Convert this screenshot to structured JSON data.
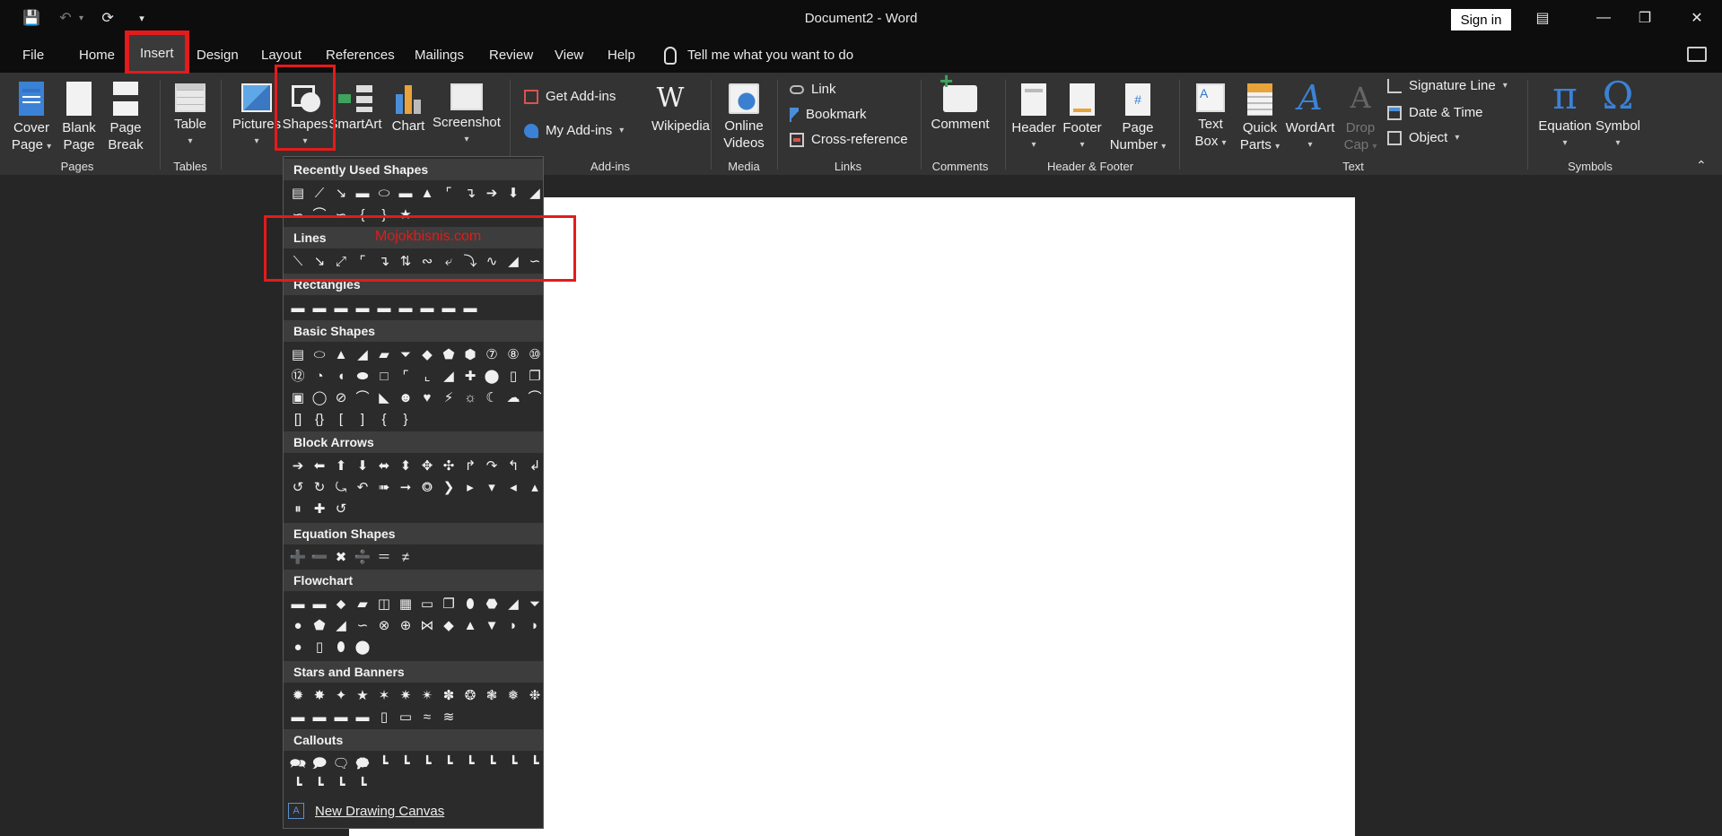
{
  "window": {
    "title": "Document2 - Word",
    "sign_in": "Sign in"
  },
  "tabs": [
    {
      "label": "File"
    },
    {
      "label": "Home"
    },
    {
      "label": "Insert"
    },
    {
      "label": "Design"
    },
    {
      "label": "Layout"
    },
    {
      "label": "References"
    },
    {
      "label": "Mailings"
    },
    {
      "label": "Review"
    },
    {
      "label": "View"
    },
    {
      "label": "Help"
    }
  ],
  "tell_me": "Tell me what you want to do",
  "ribbon": {
    "pages": {
      "label": "Pages",
      "cover": [
        "Cover",
        "Page"
      ],
      "blank": [
        "Blank",
        "Page"
      ],
      "break": [
        "Page",
        "Break"
      ]
    },
    "tables": {
      "label": "Tables",
      "table": "Table"
    },
    "illustrations": {
      "pictures": "Pictures",
      "shapes": "Shapes",
      "smartart": "SmartArt",
      "chart": "Chart",
      "screenshot": "Screenshot"
    },
    "addins": {
      "label": "Add-ins",
      "get": "Get Add-ins",
      "my": "My Add-ins",
      "wikipedia": "Wikipedia"
    },
    "media": {
      "label": "Media",
      "online": [
        "Online",
        "Videos"
      ]
    },
    "links": {
      "label": "Links",
      "link": "Link",
      "bookmark": "Bookmark",
      "cross": "Cross-reference"
    },
    "comments": {
      "label": "Comments",
      "comment": "Comment"
    },
    "headerfooter": {
      "label": "Header & Footer",
      "header": "Header",
      "footer": "Footer",
      "page_number": [
        "Page",
        "Number"
      ]
    },
    "text": {
      "label": "Text",
      "textbox": [
        "Text",
        "Box"
      ],
      "quick": [
        "Quick",
        "Parts"
      ],
      "wordart": "WordArt",
      "dropcap": [
        "Drop",
        "Cap"
      ],
      "signature": "Signature Line",
      "datetime": "Date & Time",
      "object": "Object"
    },
    "symbols": {
      "label": "Symbols",
      "equation": "Equation",
      "symbol": "Symbol"
    }
  },
  "shapes_menu": {
    "sections": [
      {
        "name": "Recently Used Shapes"
      },
      {
        "name": "Lines"
      },
      {
        "name": "Rectangles"
      },
      {
        "name": "Basic Shapes"
      },
      {
        "name": "Block Arrows"
      },
      {
        "name": "Equation Shapes"
      },
      {
        "name": "Flowchart"
      },
      {
        "name": "Stars and Banners"
      },
      {
        "name": "Callouts"
      }
    ],
    "new_canvas": "New Drawing Canvas",
    "watermark": "Mojokbisnis.com"
  }
}
